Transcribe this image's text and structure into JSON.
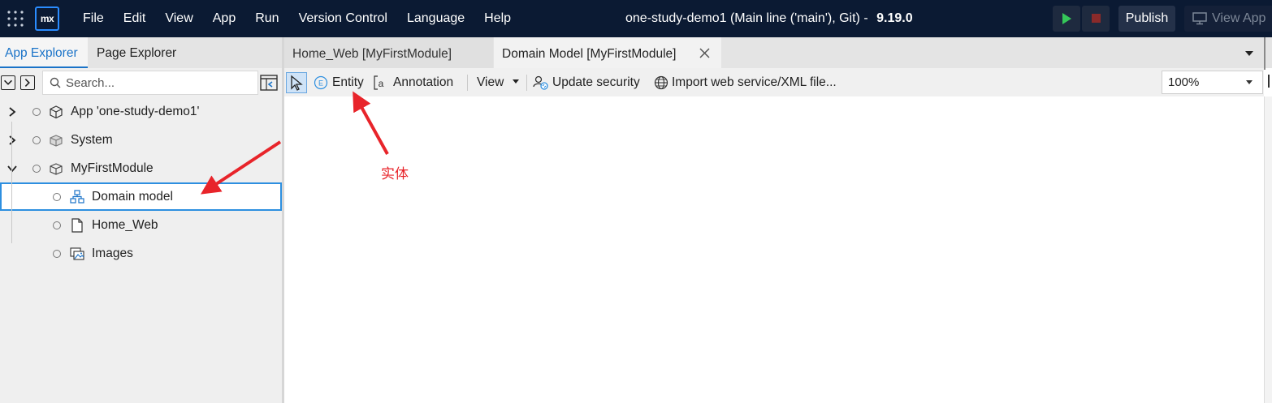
{
  "titlebar": {
    "logo_text": "mx",
    "menu": [
      "File",
      "Edit",
      "View",
      "App",
      "Run",
      "Version Control",
      "Language",
      "Help"
    ],
    "project_title": "one-study-demo1 (Main line ('main'), Git)  -",
    "version": "9.19.0",
    "publish_label": "Publish",
    "view_app_label": "View App",
    "icons": {
      "apps": "grid-icon",
      "run": "play-icon",
      "stop": "stop-icon",
      "view_app": "monitor-icon"
    }
  },
  "left_panel": {
    "tabs": [
      "App Explorer",
      "Page Explorer"
    ],
    "active_tab": "App Explorer",
    "search_placeholder": "Search...",
    "tree": [
      {
        "label": "App 'one-study-demo1'",
        "icon": "cube-icon",
        "expanded": false
      },
      {
        "label": "System",
        "icon": "module-icon",
        "expanded": false
      },
      {
        "label": "MyFirstModule",
        "icon": "module-icon",
        "expanded": true
      },
      {
        "label": "Domain model",
        "icon": "domain-model-icon",
        "selected": true
      },
      {
        "label": "Home_Web",
        "icon": "page-icon"
      },
      {
        "label": "Images",
        "icon": "images-icon"
      }
    ]
  },
  "editor": {
    "tabs": [
      {
        "label": "Home_Web [MyFirstModule]",
        "active": false
      },
      {
        "label": "Domain Model [MyFirstModule]",
        "active": true
      }
    ],
    "toolbar": {
      "entity_label": "Entity",
      "annotation_label": "Annotation",
      "view_label": "View",
      "update_security_label": "Update security",
      "import_label": "Import web service/XML file...",
      "zoom_value": "100%"
    }
  },
  "annotation": {
    "label": "实体",
    "color": "#e8242a"
  },
  "colors": {
    "titlebar_bg": "#0b1a33",
    "accent": "#1a73c8",
    "selection_border": "#2d8fe0",
    "run_green": "#35c759",
    "stop_red": "#c0392b"
  }
}
